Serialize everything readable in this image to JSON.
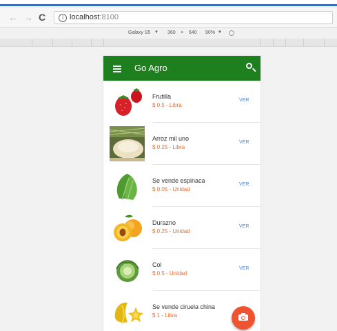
{
  "browser": {
    "url_host": "localhost",
    "url_port": ":8100",
    "device": "Galaxy S5",
    "width": "360",
    "times": "×",
    "height": "640",
    "zoom": "90%"
  },
  "app": {
    "title": "Go Agro"
  },
  "products": [
    {
      "name": "Frutilla",
      "price": "$ 0.5 - Libra",
      "action": "VER",
      "image": "strawberry"
    },
    {
      "name": "Arroz mil uno",
      "price": "$ 0.25 - Libra",
      "action": "VER",
      "image": "rice"
    },
    {
      "name": "Se vende espinaca",
      "price": "$ 0.05 - Unidad",
      "action": "VER",
      "image": "spinach"
    },
    {
      "name": "Durazno",
      "price": "$ 0.25 - Unidad",
      "action": "VER",
      "image": "peach"
    },
    {
      "name": "Col",
      "price": "$ 0.5 - Unidad",
      "action": "VER",
      "image": "cabbage"
    },
    {
      "name": "Se vende ciruela china",
      "price": "$ 1 - Libra",
      "action": "",
      "image": "starfruit"
    }
  ],
  "colors": {
    "appbar": "#1e7f1e",
    "price": "#ef6a2c",
    "link": "#4a86d4",
    "fab": "#f0532f"
  }
}
